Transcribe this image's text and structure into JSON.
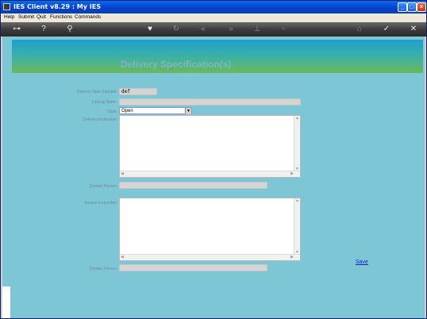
{
  "window": {
    "title": "IES Client v8.29 : My IES"
  },
  "menu": {
    "help": "Help",
    "submit": "Submit",
    "quit": "Quit",
    "functions": "Functions",
    "commands": "Commands"
  },
  "toolbar": {
    "icons": [
      "key-icon",
      "help-icon",
      "search-icon",
      "heart-icon",
      "refresh-icon",
      "back-icon",
      "forward-icon",
      "bookmark-icon",
      "page-icon",
      "home-icon",
      "check-icon",
      "close-icon"
    ]
  },
  "page": {
    "title": "Delivery Specification(s)"
  },
  "form": {
    "spec_number_label": "Delivery Spec Number",
    "spec_number_value": "def",
    "lookup_name_label": "Lookup Name",
    "lookup_name_value": "",
    "state_label": "State",
    "state_value": "Open",
    "delivery_instruction_label": "Delivery Instruction",
    "contact_person_label": "Contact Person",
    "invoice_instruction_label": "Invoice Instruction",
    "contact_person2_label": "Contact Person"
  },
  "actions": {
    "save_label": "Save"
  },
  "colors": {
    "accent": "#0a6af3",
    "client_bg": "#7dc6d5"
  }
}
